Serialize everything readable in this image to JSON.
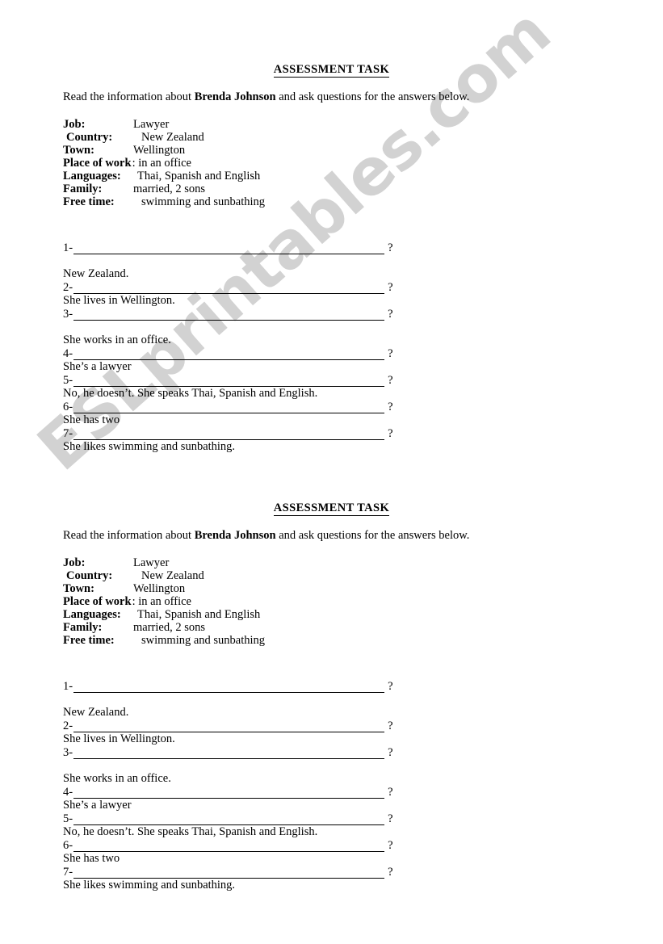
{
  "watermark": {
    "text": "ESLprintables.com",
    "color": "#d2d2d2"
  },
  "worksheet": {
    "title": "ASSESSMENT TASK",
    "intro_before": "Read the information about ",
    "intro_name": "Brenda Johnson",
    "intro_after": " and ask questions for the answers below.",
    "info": [
      {
        "label": "Job:",
        "value": "Lawyer"
      },
      {
        "label": "Country:",
        "value": "New Zealand"
      },
      {
        "label": "Town:",
        "value": "Wellington"
      },
      {
        "label": "Place of work",
        "value": ": in an office"
      },
      {
        "label": "Languages:",
        "value": "Thai, Spanish and English"
      },
      {
        "label": "Family:",
        "value": "married, 2 sons"
      },
      {
        "label": "Free time:",
        "value": "swimming and sunbathing"
      }
    ],
    "questions": [
      {
        "number": "1-",
        "mark": "?",
        "answer": "New Zealand."
      },
      {
        "number": "2-",
        "mark": "?",
        "answer": "She lives in Wellington."
      },
      {
        "number": "3-",
        "mark": "?",
        "answer": "She works in an office."
      },
      {
        "number": "4-",
        "mark": "?",
        "answer": "She’s a lawyer"
      },
      {
        "number": "5-",
        "mark": "?",
        "answer": "No, he doesn’t. She speaks Thai, Spanish and English."
      },
      {
        "number": "6-",
        "mark": "?",
        "answer": "She has two"
      },
      {
        "number": "7-",
        "mark": "?",
        "answer": "She likes swimming and sunbathing."
      }
    ]
  },
  "copies": [
    {
      "id": "copy-1"
    },
    {
      "id": "copy-2"
    }
  ]
}
